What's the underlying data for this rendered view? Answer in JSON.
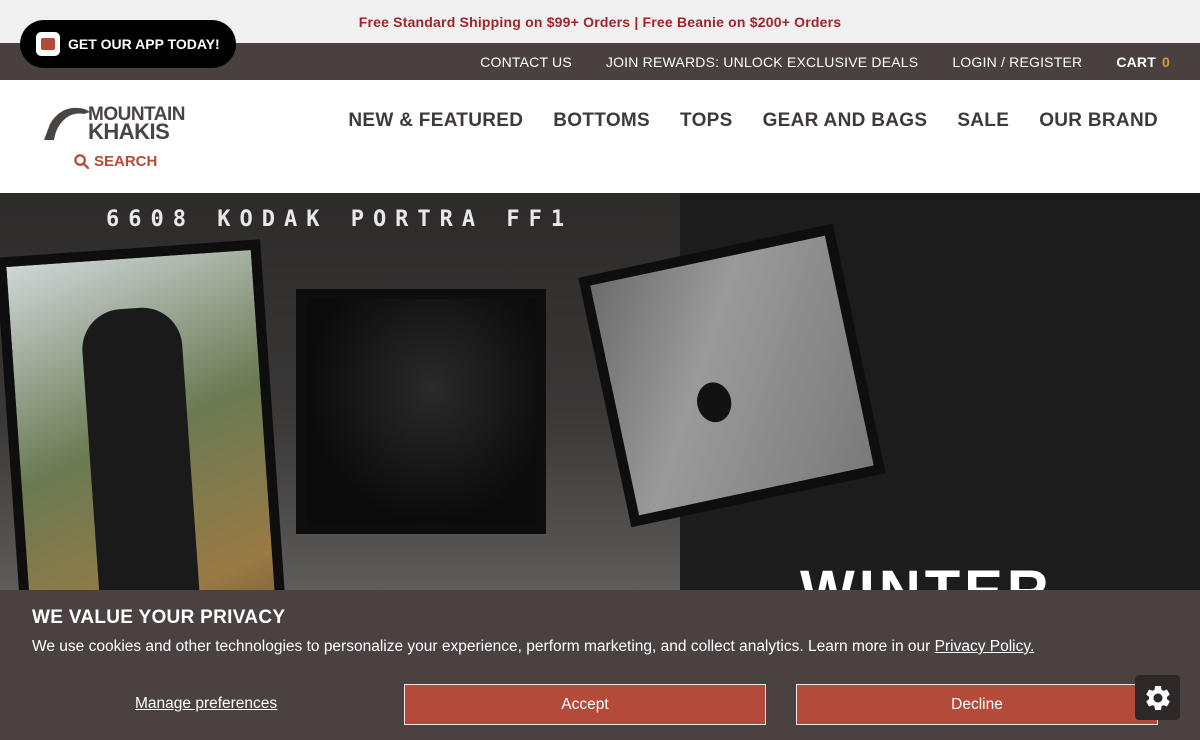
{
  "promo": {
    "text": "Free Standard Shipping on $99+ Orders | Free Beanie on $200+ Orders"
  },
  "app_banner": {
    "label": "GET OUR APP TODAY!"
  },
  "utility_nav": {
    "contact": "CONTACT US",
    "rewards": "JOIN REWARDS: UNLOCK EXCLUSIVE DEALS",
    "login": "LOGIN / REGISTER",
    "cart_label": "CART",
    "cart_count": "0"
  },
  "header": {
    "logo_line1": "MOUNTAIN",
    "logo_line2": "KHAKIS",
    "search_label": "SEARCH"
  },
  "main_nav": [
    {
      "label": "NEW & FEATURED"
    },
    {
      "label": "BOTTOMS"
    },
    {
      "label": "TOPS"
    },
    {
      "label": "GEAR AND BAGS"
    },
    {
      "label": "SALE"
    },
    {
      "label": "OUR BRAND"
    }
  ],
  "hero": {
    "film_text": "6608 KODAK PORTRA FF1",
    "headline": "WINTER"
  },
  "cookie_banner": {
    "title": "WE VALUE YOUR PRIVACY",
    "body": "We use cookies and other technologies to personalize your experience, perform marketing, and collect analytics. Learn more in our",
    "policy_link": "Privacy Policy.",
    "manage": "Manage preferences",
    "accept": "Accept",
    "decline": "Decline"
  },
  "colors": {
    "brand_red": "#b44a3a",
    "promo_text": "#a3232b",
    "util_bg": "#48413f",
    "cart_count": "#e39a2b",
    "cookie_bg": "#4a4241"
  },
  "icons": [
    "app-logo-icon",
    "search-icon",
    "mountain-logo-icon",
    "gear-icon"
  ]
}
